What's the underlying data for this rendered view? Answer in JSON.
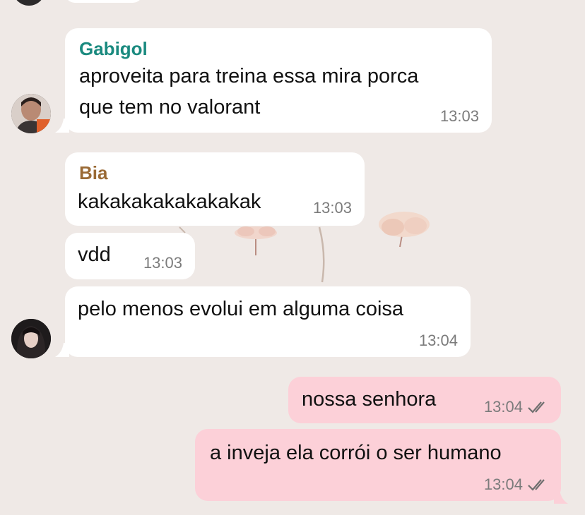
{
  "colors": {
    "background": "#efe9e6",
    "incoming_bubble": "#ffffff",
    "outgoing_bubble": "#fcd0d8",
    "sender_gabigol": "#1a8a7f",
    "sender_bia": "#9a6a35",
    "timestamp": "#7b7b7b",
    "text": "#111111"
  },
  "messages": [
    {
      "sender": "Gabigol",
      "lines": [
        "aproveita para treina essa mira porca",
        "que tem no valorant"
      ],
      "time": "13:03"
    },
    {
      "sender": "Bia",
      "text": "kakakakakakakakak",
      "time": "13:03"
    },
    {
      "text": "vdd",
      "time": "13:03"
    },
    {
      "text": "pelo menos evolui em alguma coisa",
      "time": "13:04"
    },
    {
      "text": "nossa senhora",
      "time": "13:04",
      "status_icon": "double-check-icon"
    },
    {
      "text": "a inveja ela corrói o ser humano",
      "time": "13:04",
      "status_icon": "double-check-icon"
    }
  ]
}
